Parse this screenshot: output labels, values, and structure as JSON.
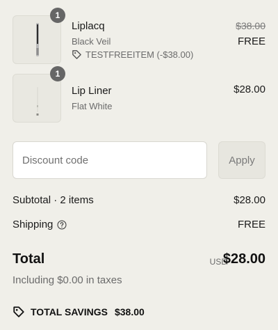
{
  "items": [
    {
      "quantity": "1",
      "name": "Liplacq",
      "variant": "Black Veil",
      "discount": "TESTFREEITEM (-$38.00)",
      "original_price": "$38.00",
      "final_price": "FREE",
      "tag_icon": "tag-icon"
    },
    {
      "quantity": "1",
      "name": "Lip Liner",
      "variant": "Flat White",
      "price": "$28.00"
    }
  ],
  "discount": {
    "placeholder": "Discount code",
    "apply_label": "Apply"
  },
  "summary": {
    "subtotal_label": "Subtotal · 2 items",
    "subtotal_value": "$28.00",
    "shipping_label": "Shipping",
    "shipping_value": "FREE",
    "help_icon": "help-circle-icon"
  },
  "total": {
    "label": "Total",
    "currency": "USD",
    "amount": "$28.00",
    "tax_note": "Including $0.00 in taxes"
  },
  "savings": {
    "label": "TOTAL SAVINGS",
    "amount": "$38.00"
  }
}
